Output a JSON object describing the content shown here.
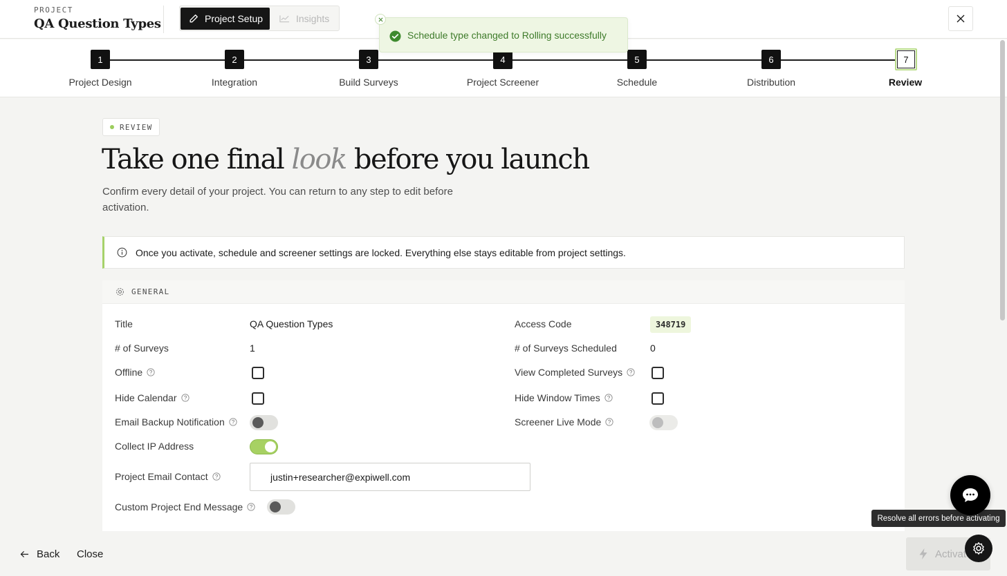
{
  "header": {
    "kicker": "PROJECT",
    "title": "QA Question Types",
    "tabs": [
      {
        "label": "Project Setup",
        "icon": "pencil-icon",
        "active": true
      },
      {
        "label": "Insights",
        "icon": "chart-line-icon",
        "active": false
      }
    ],
    "close_icon": "close-icon"
  },
  "toast": {
    "message": "Schedule type changed to Rolling successfully",
    "icon": "check-circle-icon",
    "color": "#3e7b2a"
  },
  "steps": [
    {
      "number": "1",
      "label": "Project Design"
    },
    {
      "number": "2",
      "label": "Integration"
    },
    {
      "number": "3",
      "label": "Build Surveys"
    },
    {
      "number": "4",
      "label": "Project Screener"
    },
    {
      "number": "5",
      "label": "Schedule"
    },
    {
      "number": "6",
      "label": "Distribution"
    },
    {
      "number": "7",
      "label": "Review",
      "current": true
    }
  ],
  "main": {
    "badge": "REVIEW",
    "headline_pre": "Take one final ",
    "headline_em": "look",
    "headline_post": " before you launch",
    "subtext": "Confirm every detail of your project. You can return to any step to edit before activation.",
    "notice": "Once you activate, schedule and screener settings are locked. Everything else stays editable from project settings."
  },
  "general": {
    "heading": "GENERAL",
    "title_label": "Title",
    "title_value": "QA Question Types",
    "surveys_label": "# of Surveys",
    "surveys_value": "1",
    "offline_label": "Offline",
    "offline_checked": false,
    "hide_calendar_label": "Hide Calendar",
    "hide_calendar_checked": false,
    "email_backup_label": "Email Backup Notification",
    "email_backup_on": false,
    "collect_ip_label": "Collect IP Address",
    "collect_ip_on": true,
    "email_contact_label": "Project Email Contact",
    "email_contact_value": "justin+researcher@expiwell.com",
    "custom_end_label": "Custom Project End Message",
    "custom_end_on": false,
    "access_code_label": "Access Code",
    "access_code_value": "348719",
    "scheduled_label": "# of Surveys Scheduled",
    "scheduled_value": "0",
    "view_completed_label": "View Completed Surveys",
    "view_completed_checked": false,
    "hide_window_label": "Hide Window Times",
    "hide_window_checked": false,
    "screener_live_label": "Screener Live Mode",
    "screener_live_on": false
  },
  "footer": {
    "back": "Back",
    "close": "Close",
    "activate": "Activate",
    "tooltip": "Resolve all errors before activating"
  },
  "colors": {
    "accent": "#a7d163",
    "dark": "#111111",
    "toast_bg": "#eef6e3"
  }
}
